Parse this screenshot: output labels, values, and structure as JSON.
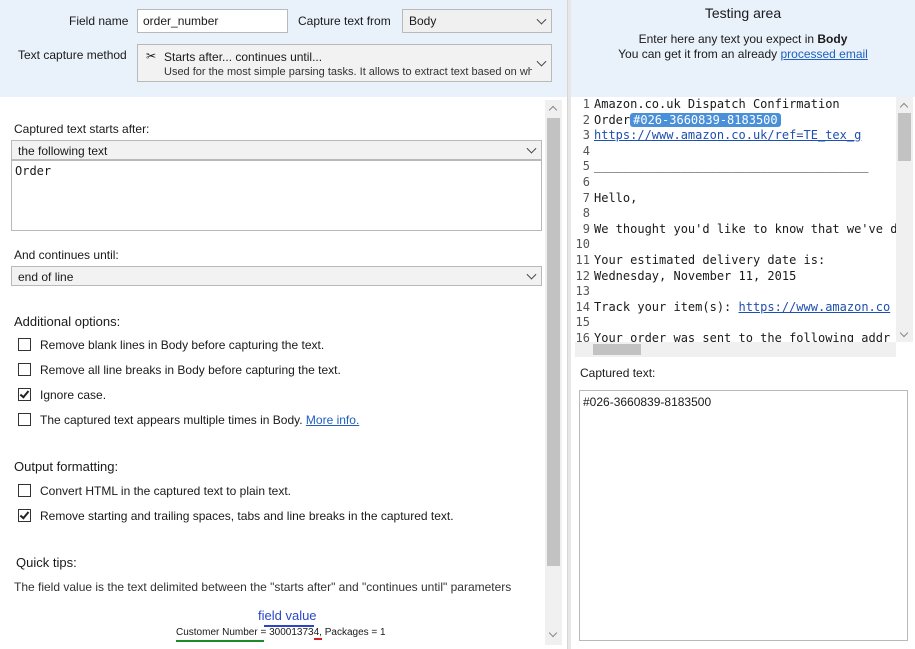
{
  "config": {
    "field_name_label": "Field name",
    "field_name_value": "order_number",
    "capture_from_label": "Capture text from",
    "capture_from_value": "Body",
    "method_label": "Text capture method",
    "method_title": "Starts after... continues until...",
    "method_desc": "Used for the most simple parsing tasks. It allows to extract text based on wh"
  },
  "left": {
    "starts_after_label": "Captured text starts after:",
    "starts_after_option": "the following text",
    "starts_after_text": "Order",
    "continues_label": "And continues until:",
    "continues_option": "end of line",
    "additional_label": "Additional options:",
    "options": [
      {
        "label": "Remove blank lines in Body before capturing the text.",
        "checked": false
      },
      {
        "label": "Remove all line breaks in Body before capturing the text.",
        "checked": false
      },
      {
        "label": "Ignore case.",
        "checked": true
      },
      {
        "label": "The captured text appears multiple times in Body.",
        "checked": false,
        "link": "More info."
      }
    ],
    "output_label": "Output formatting:",
    "output_options": [
      {
        "label": "Convert HTML in the captured text to plain text.",
        "checked": false
      },
      {
        "label": "Remove starting and trailing spaces, tabs and line breaks in the captured text.",
        "checked": true
      }
    ],
    "tips_label": "Quick tips:",
    "tips_text": "The field value is the text delimited between the \"starts after\" and \"continues until\" parameters",
    "diagram": {
      "field_value": "field value",
      "prefix": "Customer Number = ",
      "value": "300013734",
      "suffix": ", Packages = 1"
    }
  },
  "testing": {
    "title": "Testing area",
    "hint_prefix": "Enter here any text you expect in ",
    "hint_bold": "Body",
    "hint_line2_prefix": "You can get it from an already ",
    "hint_link": "processed email",
    "lines": [
      {
        "n": "1",
        "text": "Amazon.co.uk Dispatch Confirmation"
      },
      {
        "n": "2",
        "pre": "Order",
        "highlight": "#026-3660839-8183500"
      },
      {
        "n": "3",
        "url": "https://www.amazon.co.uk/ref=TE_tex_g"
      },
      {
        "n": "4",
        "text": ""
      },
      {
        "n": "5",
        "text": "______________________________________"
      },
      {
        "n": "6",
        "text": ""
      },
      {
        "n": "7",
        "text": "Hello,"
      },
      {
        "n": "8",
        "text": ""
      },
      {
        "n": "9",
        "text": "We thought you'd like to know that we've d"
      },
      {
        "n": "10",
        "text": ""
      },
      {
        "n": "11",
        "text": "Your estimated delivery date is:"
      },
      {
        "n": "12",
        "text": "Wednesday, November 11, 2015"
      },
      {
        "n": "13",
        "text": ""
      },
      {
        "n": "14",
        "pre": "Track your item(s): ",
        "url": "https://www.amazon.co"
      },
      {
        "n": "15",
        "text": ""
      },
      {
        "n": "16",
        "text": "Your order was sent to the following addr"
      }
    ],
    "captured_label": "Captured text:",
    "captured_value": "#026-3660839-8183500"
  }
}
